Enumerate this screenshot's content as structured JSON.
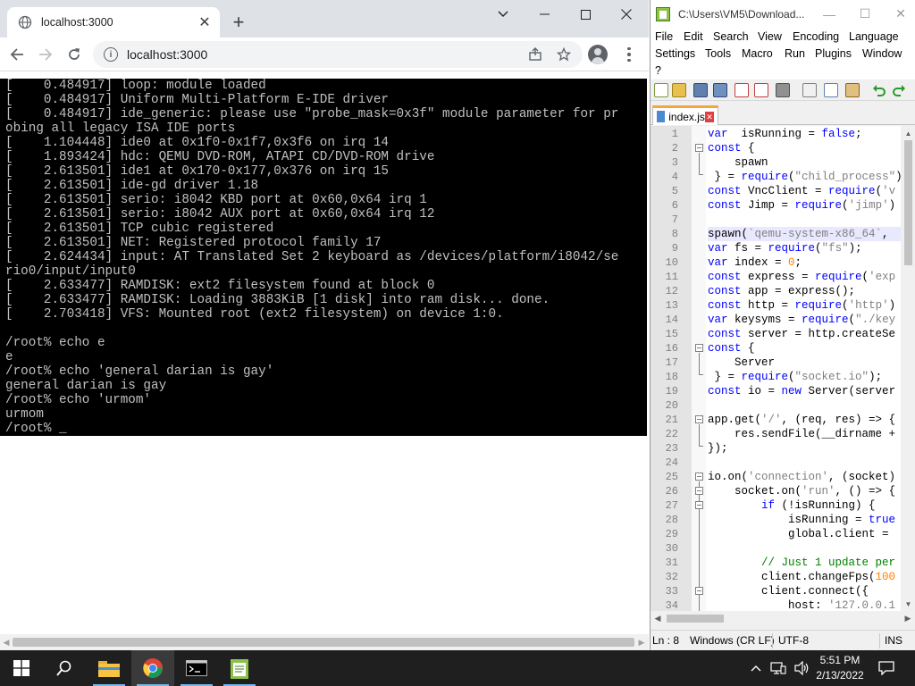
{
  "chrome": {
    "tab_title": "localhost:3000",
    "url": "localhost:3000",
    "terminal_lines": [
      "[    0.484917] loop: module loaded",
      "[    0.484917] Uniform Multi-Platform E-IDE driver",
      "[    0.484917] ide_generic: please use \"probe_mask=0x3f\" module parameter for pr",
      "obing all legacy ISA IDE ports",
      "[    1.104448] ide0 at 0x1f0-0x1f7,0x3f6 on irq 14",
      "[    1.893424] hdc: QEMU DVD-ROM, ATAPI CD/DVD-ROM drive",
      "[    2.613501] ide1 at 0x170-0x177,0x376 on irq 15",
      "[    2.613501] ide-gd driver 1.18",
      "[    2.613501] serio: i8042 KBD port at 0x60,0x64 irq 1",
      "[    2.613501] serio: i8042 AUX port at 0x60,0x64 irq 12",
      "[    2.613501] TCP cubic registered",
      "[    2.613501] NET: Registered protocol family 17",
      "[    2.624434] input: AT Translated Set 2 keyboard as /devices/platform/i8042/se",
      "rio0/input/input0",
      "[    2.633477] RAMDISK: ext2 filesystem found at block 0",
      "[    2.633477] RAMDISK: Loading 3883KiB [1 disk] into ram disk... done.",
      "[    2.703418] VFS: Mounted root (ext2 filesystem) on device 1:0.",
      "",
      "/root% echo e",
      "e",
      "/root% echo 'general darian is gay'",
      "general darian is gay",
      "/root% echo 'urmom'",
      "urmom",
      "/root% _"
    ]
  },
  "npp": {
    "title": "C:\\Users\\VM5\\Download...",
    "menu": [
      "File",
      "Edit",
      "Search",
      "View",
      "Encoding",
      "Language",
      "Settings",
      "Tools",
      "Macro",
      "Run",
      "Plugins",
      "Window",
      "?"
    ],
    "tab_label": "index.js",
    "line_numbers": [
      "1",
      "2",
      "3",
      "4",
      "5",
      "6",
      "7",
      "8",
      "9",
      "10",
      "11",
      "12",
      "13",
      "14",
      "15",
      "16",
      "17",
      "18",
      "19",
      "20",
      "21",
      "22",
      "23",
      "24",
      "25",
      "26",
      "27",
      "28",
      "29",
      "30",
      "31",
      "32",
      "33",
      "34"
    ],
    "code_lines": [
      [
        [
          "kw",
          "var"
        ],
        [
          "",
          "  isRunning = "
        ],
        [
          "kw",
          "false"
        ],
        [
          "",
          ";"
        ]
      ],
      [
        [
          "kw",
          "const"
        ],
        [
          "",
          " {"
        ]
      ],
      [
        [
          "",
          "    spawn"
        ]
      ],
      [
        [
          "",
          " } = "
        ],
        [
          "kw",
          "require"
        ],
        [
          "",
          "("
        ],
        [
          "st",
          "\"child_process\""
        ],
        [
          "",
          ")"
        ]
      ],
      [
        [
          "kw",
          "const"
        ],
        [
          "",
          " VncClient = "
        ],
        [
          "kw",
          "require"
        ],
        [
          "",
          "("
        ],
        [
          "st",
          "'v"
        ]
      ],
      [
        [
          "kw",
          "const"
        ],
        [
          "",
          " Jimp = "
        ],
        [
          "kw",
          "require"
        ],
        [
          "",
          "("
        ],
        [
          "st",
          "'jimp'"
        ],
        [
          "",
          ")"
        ]
      ],
      [
        [
          "",
          ""
        ]
      ],
      [
        [
          "",
          "spawn("
        ],
        [
          "st",
          "`qemu-system-x86_64`"
        ],
        [
          "",
          ","
        ]
      ],
      [
        [
          "kw",
          "var"
        ],
        [
          "",
          " fs = "
        ],
        [
          "kw",
          "require"
        ],
        [
          "",
          "("
        ],
        [
          "st",
          "\"fs\""
        ],
        [
          "",
          ");"
        ]
      ],
      [
        [
          "kw",
          "var"
        ],
        [
          "",
          " index = "
        ],
        [
          "nm",
          "0"
        ],
        [
          "",
          ";"
        ]
      ],
      [
        [
          "kw",
          "const"
        ],
        [
          "",
          " express = "
        ],
        [
          "kw",
          "require"
        ],
        [
          "",
          "("
        ],
        [
          "st",
          "'exp"
        ]
      ],
      [
        [
          "kw",
          "const"
        ],
        [
          "",
          " app = express();"
        ]
      ],
      [
        [
          "kw",
          "const"
        ],
        [
          "",
          " http = "
        ],
        [
          "kw",
          "require"
        ],
        [
          "",
          "("
        ],
        [
          "st",
          "'http'"
        ],
        [
          "",
          ")"
        ]
      ],
      [
        [
          "kw",
          "var"
        ],
        [
          "",
          " keysyms = "
        ],
        [
          "kw",
          "require"
        ],
        [
          "",
          "("
        ],
        [
          "st",
          "\"./key"
        ]
      ],
      [
        [
          "kw",
          "const"
        ],
        [
          "",
          " server = http.createSe"
        ]
      ],
      [
        [
          "kw",
          "const"
        ],
        [
          "",
          " {"
        ]
      ],
      [
        [
          "",
          "    Server"
        ]
      ],
      [
        [
          "",
          " } = "
        ],
        [
          "kw",
          "require"
        ],
        [
          "",
          "("
        ],
        [
          "st",
          "\"socket.io\""
        ],
        [
          "",
          ");"
        ]
      ],
      [
        [
          "kw",
          "const"
        ],
        [
          "",
          " io = "
        ],
        [
          "kw",
          "new"
        ],
        [
          "",
          " Server(server"
        ]
      ],
      [
        [
          "",
          ""
        ]
      ],
      [
        [
          "",
          "app.get("
        ],
        [
          "st",
          "'/'"
        ],
        [
          "",
          ", (req, res) => {"
        ]
      ],
      [
        [
          "",
          "    res.sendFile(__dirname +"
        ]
      ],
      [
        [
          "",
          "});"
        ]
      ],
      [
        [
          "",
          ""
        ]
      ],
      [
        [
          "",
          "io.on("
        ],
        [
          "st",
          "'connection'"
        ],
        [
          "",
          ", (socket)"
        ]
      ],
      [
        [
          "",
          "    socket.on("
        ],
        [
          "st",
          "'run'"
        ],
        [
          "",
          ", () => {"
        ]
      ],
      [
        [
          "",
          "        "
        ],
        [
          "kw",
          "if"
        ],
        [
          "",
          " (!isRunning) {"
        ]
      ],
      [
        [
          "",
          "            isRunning = "
        ],
        [
          "kw",
          "true"
        ]
      ],
      [
        [
          "",
          "            global.client ="
        ]
      ],
      [
        [
          "",
          ""
        ]
      ],
      [
        [
          "",
          "        "
        ],
        [
          "cm",
          "// Just 1 update per"
        ]
      ],
      [
        [
          "",
          "        client.changeFps("
        ],
        [
          "nm",
          "100"
        ]
      ],
      [
        [
          "",
          "        client.connect({"
        ]
      ],
      [
        [
          "",
          "            host: "
        ],
        [
          "st",
          "'127.0.0.1"
        ]
      ]
    ],
    "status": {
      "pos": "Ln : 8",
      "eol": "Windows (CR LF)",
      "encoding": "UTF-8",
      "mode": "INS"
    }
  },
  "taskbar": {
    "time": "5:51 PM",
    "date": "2/13/2022"
  },
  "colors": {
    "chrome_frame": "#dee1e6",
    "terminal_bg": "#000000",
    "terminal_fg": "#c0c0c0",
    "npp_keyword": "#0000ff",
    "npp_string": "#808080",
    "taskbar_bg": "#1f1f1f"
  }
}
